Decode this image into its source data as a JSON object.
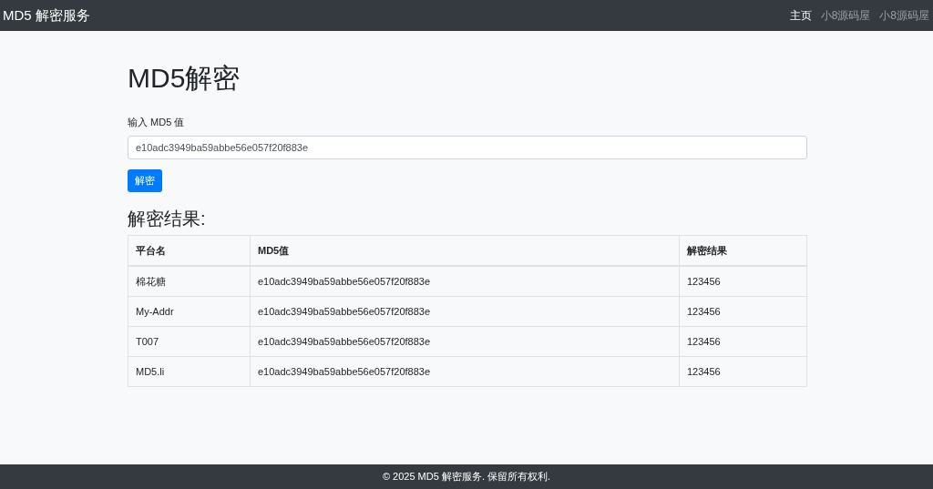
{
  "navbar": {
    "brand": "MD5 解密服务",
    "links": [
      {
        "label": "主页",
        "selected": true
      },
      {
        "label": "小8源码屋",
        "selected": false
      },
      {
        "label": "小8源码屋",
        "selected": false
      }
    ]
  },
  "title": "MD5解密",
  "input": {
    "label": "输入 MD5 值",
    "value": "e10adc3949ba59abbe56e057f20f883e"
  },
  "submit_button": "解密",
  "results": {
    "heading": "解密结果:",
    "columns": [
      "平台名",
      "MD5值",
      "解密结果"
    ],
    "rows": [
      [
        "棉花糖",
        "e10adc3949ba59abbe56e057f20f883e",
        "123456"
      ],
      [
        "My-Addr",
        "e10adc3949ba59abbe56e057f20f883e",
        "123456"
      ],
      [
        "T007",
        "e10adc3949ba59abbe56e057f20f883e",
        "123456"
      ],
      [
        "MD5.li",
        "e10adc3949ba59abbe56e057f20f883e",
        "123456"
      ]
    ]
  },
  "footer": "© 2025 MD5 解密服务. 保留所有权利."
}
